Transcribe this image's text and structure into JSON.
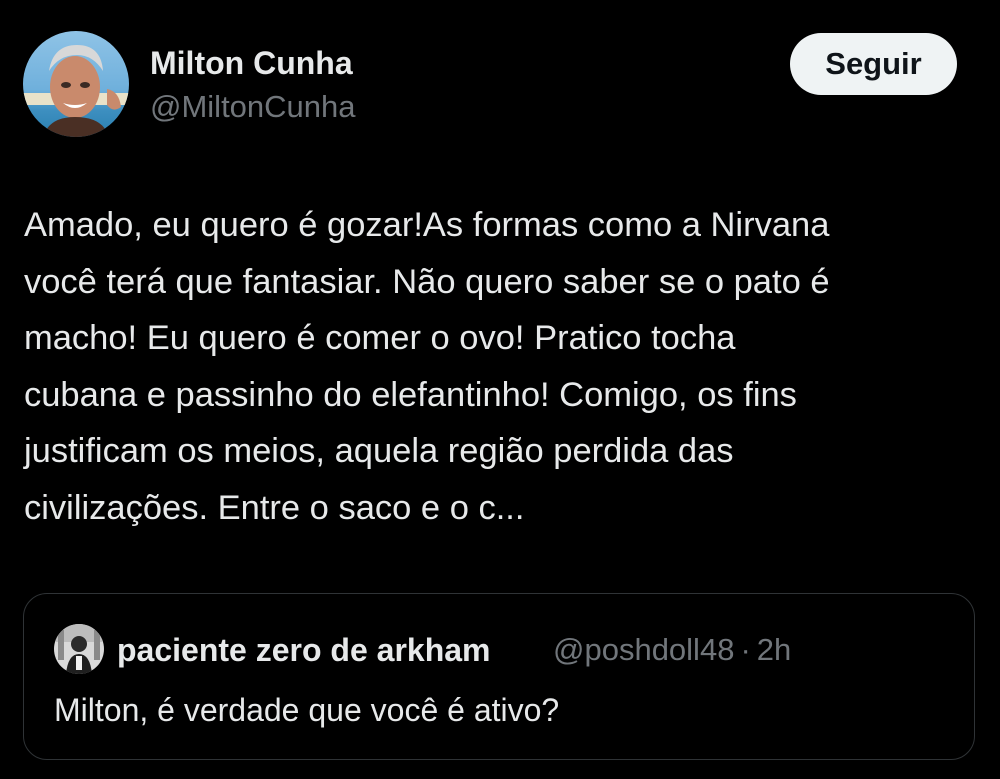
{
  "author": {
    "display_name": "Milton Cunha",
    "handle": "@MiltonCunha",
    "avatar_icon": "user-photo-avatar"
  },
  "follow_button": {
    "label": "Seguir"
  },
  "tweet": {
    "lines": [
      "Amado, eu quero é gozar!As formas como a Nirvana",
      "você terá que fantasiar. Não quero saber se o pato é",
      "macho! Eu quero é comer o ovo! Pratico tocha",
      "cubana e passinho do elefantinho! Comigo, os fins",
      "justificam os meios, aquela região perdida das",
      "civilizações. Entre o saco e o c..."
    ]
  },
  "quoted_tweet": {
    "display_name": "paciente zero de arkham",
    "handle": "@poshdoll48",
    "separator": "·",
    "time": "2h",
    "text": "Milton, é verdade que você é ativo?",
    "avatar_icon": "user-photo-avatar"
  },
  "colors": {
    "background": "#000000",
    "primary_text": "#e7e9ea",
    "secondary_text": "#71767b",
    "border": "#2f3336",
    "button_bg": "#eff3f4",
    "button_text": "#0f1419"
  }
}
